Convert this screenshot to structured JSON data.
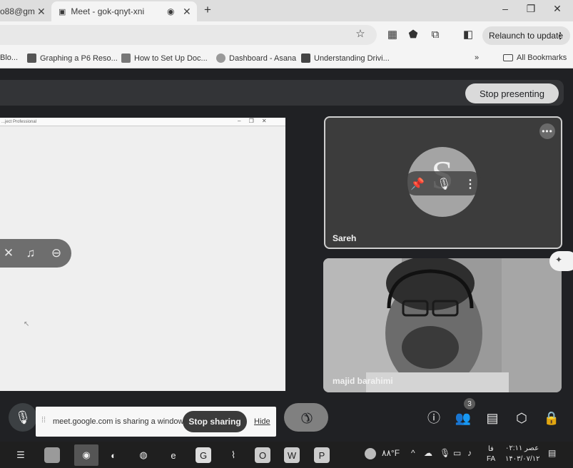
{
  "browser": {
    "tabs": [
      {
        "title": "o88@gm",
        "active": false
      },
      {
        "title": "Meet - gok-qnyt-xni",
        "active": true
      }
    ],
    "new_tab": "+",
    "window_controls": [
      "–",
      "❐",
      "✕"
    ],
    "relaunch_label": "Relaunch to update",
    "bookmarks": [
      {
        "label": "Blo...",
        "icon": "page-icon"
      },
      {
        "label": "Graphing a P6 Reso...",
        "icon": "chart-icon"
      },
      {
        "label": "How to Set Up Doc...",
        "icon": "doc-icon"
      },
      {
        "label": "Dashboard - Asana",
        "icon": "asana-icon"
      },
      {
        "label": "Understanding Drivi...",
        "icon": "grid-icon"
      }
    ],
    "all_bookmarks": "All Bookmarks",
    "more_bookmarks": "»"
  },
  "meet": {
    "stop_presenting": "Stop presenting",
    "shared_window_title": "...ject Professional",
    "participants": [
      {
        "name": "Sareh",
        "avatar_letter": "S"
      },
      {
        "name": "majid barahimi"
      }
    ],
    "more_options": "•••",
    "people_count": "3",
    "sharing_banner": {
      "text": "meet.google.com is sharing a window.",
      "stop_label": "Stop sharing",
      "hide_label": "Hide"
    }
  },
  "taskbar": {
    "weather": "۸۸°F",
    "lang_top": "فا",
    "lang": "FA",
    "time": "عصر ۰۲:۱۱",
    "date": "۱۴۰۳/۰۷/۱۲"
  },
  "colors": {
    "meet_bg": "#202124",
    "chrome_bg": "#f4f4f4"
  }
}
